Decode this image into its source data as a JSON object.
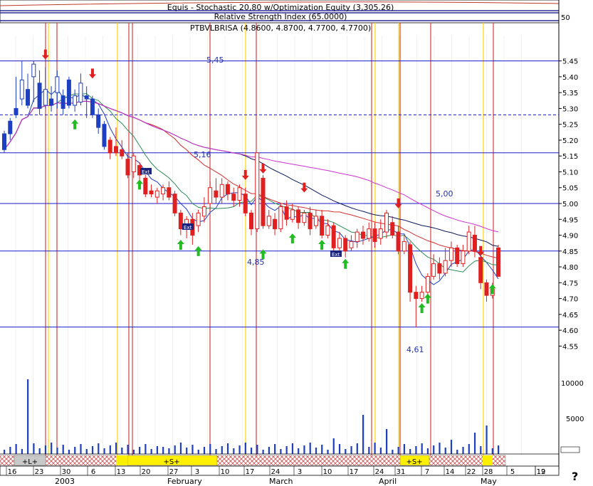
{
  "chart_data": {
    "type": "candlestick",
    "title_lines": [
      "Equis - Stochastic 20,80  w/Optimization Equity (3,305.26)",
      "Relative Strength Index (65.0000)",
      "PTBVLBRISA (4.8600, 4.8700, 4.7700, 4.7700)"
    ],
    "top_panel": {
      "tick_label": "50"
    },
    "price_axis": {
      "ylim": [
        4.47,
        5.53
      ],
      "ticks": [
        "5.45",
        "5.40",
        "5.35",
        "5.30",
        "5.25",
        "5.20",
        "5.15",
        "5.10",
        "5.05",
        "5.00",
        "4.95",
        "4.90",
        "4.85",
        "4.80",
        "4.75",
        "4.70",
        "4.65",
        "4.60",
        "4.55"
      ]
    },
    "volume_axis": {
      "ticks": [
        "10000",
        "5000"
      ],
      "top_label": ""
    },
    "x_axis": {
      "day_labels": [
        "16",
        "23",
        "30",
        "6",
        "13",
        "20",
        "27",
        "3",
        "10",
        "17",
        "24",
        "3",
        "10",
        "17",
        "24",
        "31",
        "7",
        "14",
        "22",
        "28",
        "5",
        "12",
        "19"
      ],
      "month_labels": [
        "2003",
        "February",
        "March",
        "April",
        "May"
      ],
      "corner_label": "?"
    },
    "price_levels": [
      {
        "label": "5,45",
        "value": 5.45
      },
      {
        "label": "5,16",
        "value": 5.16
      },
      {
        "label": "5,00",
        "value": 5.0
      },
      {
        "label": "4,85",
        "value": 4.85
      },
      {
        "label": "4,61",
        "value": 4.61
      }
    ],
    "dashed_level": 5.28,
    "signal_bar": {
      "segments": [
        {
          "label": "+L+",
          "from": 1,
          "to": 3
        },
        {
          "label": "+S+",
          "from": 16,
          "to": 24
        },
        {
          "label": "+S+",
          "from": 64,
          "to": 68
        }
      ]
    },
    "ext_labels": [
      "Ext",
      "Ext",
      "Ext"
    ],
    "candles": [
      [
        5.22,
        5.17,
        5.23,
        5.16
      ],
      [
        5.26,
        5.22,
        5.27,
        5.2
      ],
      [
        5.3,
        5.28,
        5.4,
        5.27
      ],
      [
        5.33,
        5.39,
        5.45,
        5.31
      ],
      [
        5.36,
        5.31,
        5.41,
        5.3
      ],
      [
        5.4,
        5.44,
        5.45,
        5.32
      ],
      [
        5.38,
        5.3,
        5.42,
        5.28
      ],
      [
        5.31,
        5.36,
        5.43,
        5.3
      ],
      [
        5.33,
        5.31,
        5.37,
        5.29
      ],
      [
        5.35,
        5.4,
        5.42,
        5.3
      ],
      [
        5.34,
        5.3,
        5.36,
        5.28
      ],
      [
        5.39,
        5.31,
        5.4,
        5.3
      ],
      [
        5.31,
        5.34,
        5.36,
        5.29
      ],
      [
        5.32,
        5.38,
        5.41,
        5.31
      ],
      [
        5.34,
        5.33,
        5.37,
        5.27
      ],
      [
        5.33,
        5.28,
        5.34,
        5.27
      ],
      [
        5.28,
        5.24,
        5.3,
        5.22
      ],
      [
        5.25,
        5.18,
        5.26,
        5.17
      ],
      [
        5.2,
        5.16,
        5.21,
        5.14
      ],
      [
        5.18,
        5.16,
        5.24,
        5.15
      ],
      [
        5.17,
        5.15,
        5.2,
        5.14
      ],
      [
        5.14,
        5.09,
        5.16,
        5.08
      ],
      [
        5.1,
        5.15,
        5.16,
        5.08
      ],
      [
        5.12,
        5.09,
        5.13,
        5.07
      ],
      [
        5.08,
        5.03,
        5.09,
        5.02
      ],
      [
        5.04,
        5.03,
        5.06,
        5.02
      ],
      [
        5.02,
        5.04,
        5.05,
        5.0
      ],
      [
        5.03,
        5.05,
        5.06,
        5.01
      ],
      [
        5.05,
        5.02,
        5.07,
        5.01
      ],
      [
        5.03,
        4.97,
        5.04,
        4.96
      ],
      [
        4.97,
        4.92,
        4.98,
        4.9
      ],
      [
        4.92,
        4.95,
        4.96,
        4.89
      ],
      [
        4.95,
        4.9,
        4.97,
        4.87
      ],
      [
        4.93,
        4.97,
        4.98,
        4.91
      ],
      [
        4.96,
        4.99,
        5.02,
        4.94
      ],
      [
        5.0,
        5.05,
        5.07,
        4.98
      ],
      [
        5.04,
        5.02,
        5.08,
        5.0
      ],
      [
        5.02,
        5.06,
        5.08,
        5.0
      ],
      [
        5.06,
        5.03,
        5.07,
        5.01
      ],
      [
        5.03,
        5.01,
        5.05,
        4.99
      ],
      [
        5.01,
        5.05,
        5.06,
        4.99
      ],
      [
        5.03,
        4.97,
        5.05,
        4.96
      ],
      [
        4.97,
        4.92,
        4.98,
        4.9
      ],
      [
        4.92,
        5.16,
        5.16,
        4.91
      ],
      [
        5.08,
        4.93,
        5.09,
        4.92
      ],
      [
        4.93,
        4.96,
        4.98,
        4.92
      ],
      [
        4.95,
        4.92,
        4.97,
        4.9
      ],
      [
        4.92,
        4.99,
        5.0,
        4.91
      ],
      [
        4.99,
        4.95,
        5.01,
        4.93
      ],
      [
        4.95,
        4.98,
        5.0,
        4.94
      ],
      [
        4.98,
        4.94,
        4.99,
        4.92
      ],
      [
        4.94,
        4.97,
        4.98,
        4.93
      ],
      [
        4.97,
        4.92,
        4.99,
        4.9
      ],
      [
        4.93,
        4.96,
        4.98,
        4.92
      ],
      [
        4.96,
        4.9,
        4.98,
        4.89
      ],
      [
        4.9,
        4.93,
        4.95,
        4.89
      ],
      [
        4.93,
        4.86,
        4.94,
        4.85
      ],
      [
        4.86,
        4.89,
        4.91,
        4.84
      ],
      [
        4.89,
        4.85,
        4.9,
        4.83
      ],
      [
        4.86,
        4.88,
        4.9,
        4.85
      ],
      [
        4.88,
        4.91,
        4.92,
        4.86
      ],
      [
        4.91,
        4.89,
        4.93,
        4.87
      ],
      [
        4.89,
        4.92,
        4.94,
        4.88
      ],
      [
        4.92,
        4.88,
        4.94,
        4.86
      ],
      [
        4.89,
        4.92,
        4.95,
        4.87
      ],
      [
        4.91,
        4.97,
        4.98,
        4.89
      ],
      [
        4.94,
        4.9,
        4.96,
        4.89
      ],
      [
        4.91,
        4.85,
        4.93,
        4.84
      ],
      [
        4.85,
        4.88,
        4.9,
        4.84
      ],
      [
        4.87,
        4.72,
        4.88,
        4.69
      ],
      [
        4.72,
        4.7,
        4.74,
        4.61
      ],
      [
        4.7,
        4.72,
        4.74,
        4.69
      ],
      [
        4.72,
        4.77,
        4.78,
        4.71
      ],
      [
        4.77,
        4.81,
        4.84,
        4.76
      ],
      [
        4.81,
        4.78,
        4.83,
        4.76
      ],
      [
        4.78,
        4.82,
        4.86,
        4.77
      ],
      [
        4.82,
        4.86,
        4.88,
        4.8
      ],
      [
        4.86,
        4.81,
        4.87,
        4.8
      ],
      [
        4.81,
        4.85,
        4.87,
        4.8
      ],
      [
        4.85,
        4.91,
        4.93,
        4.84
      ],
      [
        4.9,
        4.85,
        4.93,
        4.83
      ],
      [
        4.83,
        4.75,
        4.84,
        4.73
      ],
      [
        4.75,
        4.71,
        4.76,
        4.69
      ],
      [
        4.71,
        4.73,
        4.75,
        4.7
      ],
      [
        4.86,
        4.77,
        4.87,
        4.77
      ]
    ]
  }
}
